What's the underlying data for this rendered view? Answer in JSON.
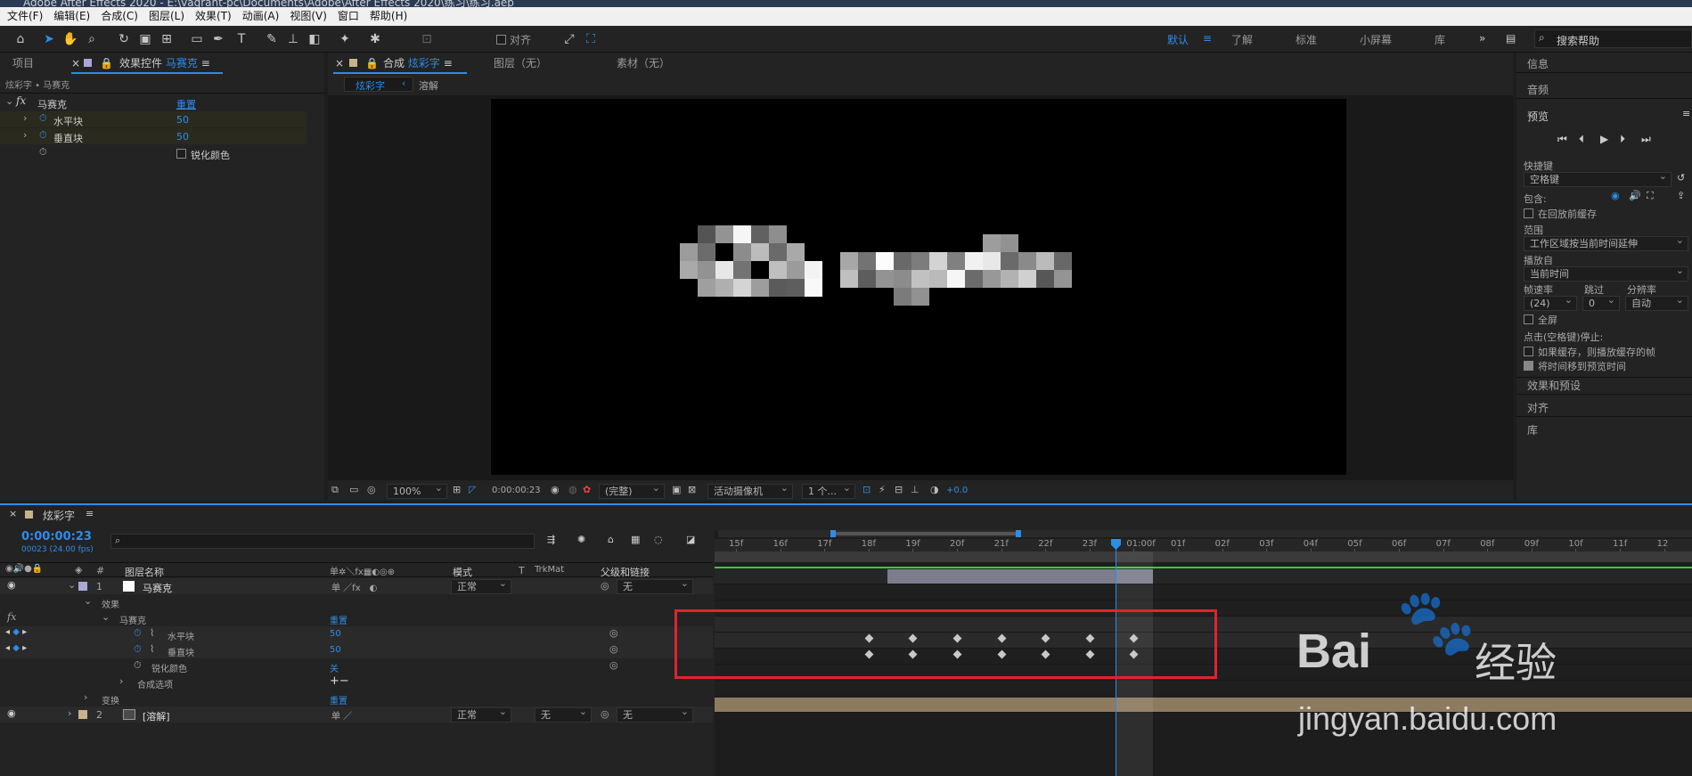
{
  "window_title": "Adobe After Effects 2020 - E:\\vagrant-pc\\Documents\\Adobe\\After Effects 2020\\练习\\练习.aep",
  "menu": [
    "文件(F)",
    "编辑(E)",
    "合成(C)",
    "图层(L)",
    "效果(T)",
    "动画(A)",
    "视图(V)",
    "窗口",
    "帮助(H)"
  ],
  "toolbar": {
    "align_label": "对齐",
    "workspaces": [
      "默认",
      "了解",
      "标准",
      "小屏幕",
      "库"
    ],
    "active_workspace": "默认",
    "search_placeholder": "搜索帮助"
  },
  "project_panel": {
    "tab_project": "项目",
    "tab_effects": "效果控件",
    "tab_effects_target": "马赛克",
    "breadcrumb": "炫彩字 • 马赛克"
  },
  "effect_controls": {
    "fx_label": "fx",
    "effect_name": "马赛克",
    "reset": "重置",
    "props": [
      {
        "name": "水平块",
        "value": "50"
      },
      {
        "name": "垂直块",
        "value": "50"
      }
    ],
    "sharpen_label": "锐化颜色"
  },
  "comp_panel": {
    "tab_comp_prefix": "合成",
    "tab_comp_name": "炫彩字",
    "tab_layer": "图层（无）",
    "tab_footage": "素材（无）",
    "nav_active": "炫彩字",
    "nav_next": "溶解",
    "zoom": "100%",
    "timecode": "0:00:00:23",
    "resolution": "(完整)",
    "camera": "活动摄像机",
    "views": "1 个...",
    "exposure": "+0.0"
  },
  "right_panel": {
    "info": "信息",
    "audio": "音频",
    "preview": "预览",
    "shortcut_label": "快捷键",
    "shortcut_value": "空格键",
    "include_label": "包含:",
    "cache_before": "在回放前缓存",
    "range_label": "范围",
    "range_value": "工作区域按当前时间延伸",
    "play_from_label": "播放自",
    "play_from_value": "当前时间",
    "framerate_label": "帧速率",
    "skip_label": "跳过",
    "resolution_label": "分辨率",
    "framerate_value": "(24)",
    "skip_value": "0",
    "resolution_value": "自动",
    "fullscreen": "全屏",
    "stop_label": "点击(空格键)停止:",
    "stop_opt1": "如果缓存，则播放缓存的帧",
    "stop_opt2": "将时间移到预览时间",
    "effects_presets": "效果和预设",
    "align": "对齐",
    "library": "库"
  },
  "timeline": {
    "tab_name": "炫彩字",
    "timecode": "0:00:00:23",
    "timecode_sub": "00023 (24.00 fps)",
    "col_num": "#",
    "col_name": "图层名称",
    "col_mode": "模式",
    "col_t": "T",
    "col_trkmat": "TrkMat",
    "col_parent": "父级和链接",
    "ruler": [
      "15f",
      "16f",
      "17f",
      "18f",
      "19f",
      "20f",
      "21f",
      "22f",
      "23f",
      "01:00f",
      "01f",
      "02f",
      "03f",
      "04f",
      "05f",
      "06f",
      "07f",
      "08f",
      "09f",
      "10f",
      "11f",
      "12"
    ],
    "layer1": {
      "num": "1",
      "name": "马赛克",
      "mode": "正常",
      "parent": "无"
    },
    "effects_group": "效果",
    "effect_name": "马赛克",
    "effect_reset": "重置",
    "prop_h": {
      "name": "水平块",
      "value": "50"
    },
    "prop_v": {
      "name": "垂直块",
      "value": "50"
    },
    "sharpen": {
      "name": "锐化颜色",
      "value": "关"
    },
    "comp_options": "合成选项",
    "comp_options_ctrl": "+−",
    "transform": "变换",
    "transform_reset": "重置",
    "layer2": {
      "num": "2",
      "name": "[溶解]",
      "mode": "正常",
      "trkmat": "无",
      "parent": "无"
    },
    "keyframe_frames": [
      18,
      19,
      20,
      21,
      22,
      23,
      24
    ]
  },
  "watermark": {
    "brand": "Bai",
    "brand2": "经验",
    "url": "jingyan.baidu.com"
  },
  "colors": {
    "accent": "#2d8ceb",
    "highlight_box": "#e0242c",
    "layer1_label": "#a9a9d6",
    "layer2_label": "#c7b38a"
  }
}
